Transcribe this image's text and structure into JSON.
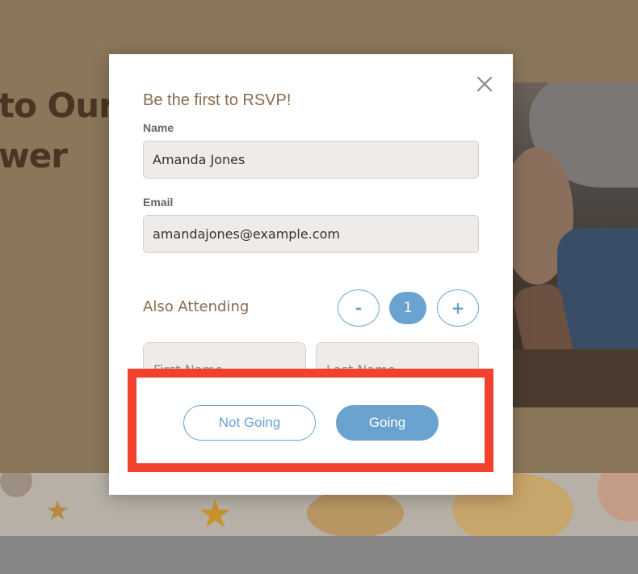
{
  "background": {
    "hero_title": "to Our\nwer"
  },
  "modal": {
    "heading": "Be the first to RSVP!",
    "name_label": "Name",
    "name_value": "Amanda Jones",
    "email_label": "Email",
    "email_value": "amandajones@example.com",
    "also_attending_label": "Also Attending",
    "decrement_label": "-",
    "guest_count": "1",
    "increment_label": "+",
    "first_name_placeholder": "First Name",
    "last_name_placeholder": "Last Name",
    "not_going_label": "Not Going",
    "going_label": "Going"
  },
  "colors": {
    "accent": "#6aa3d0",
    "heading_brown": "#8c6a4e",
    "highlight_red": "#f2412d"
  }
}
